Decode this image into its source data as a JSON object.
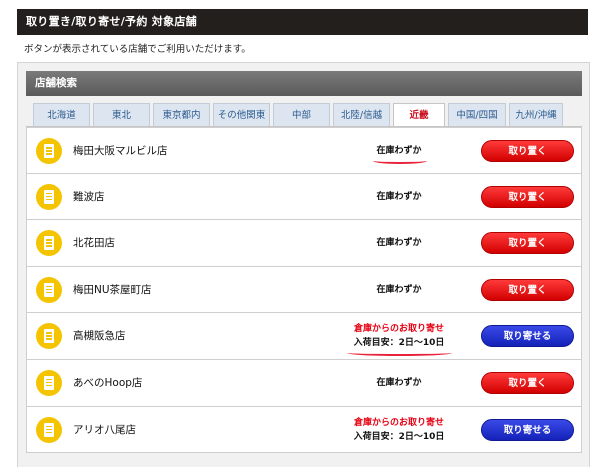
{
  "header": {
    "title": "取り置き/取り寄せ/予約 対象店舗",
    "subtitle": "ボタンが表示されている店舗でご利用いただけます。"
  },
  "panel": {
    "title": "店舗検索"
  },
  "tabs": [
    {
      "label": "北海道",
      "width": 57
    },
    {
      "label": "東北",
      "width": 57
    },
    {
      "label": "東京都内",
      "width": 57
    },
    {
      "label": "その他関東",
      "width": 57
    },
    {
      "label": "中部",
      "width": 57
    },
    {
      "label": "北陸/信越",
      "width": 57
    },
    {
      "label": "近畿",
      "width": 52
    },
    {
      "label": "中国/四国",
      "width": 58
    },
    {
      "label": "九州/沖縄",
      "width": 54
    }
  ],
  "active_tab": "近畿",
  "stores": [
    {
      "name": "梅田大阪マルビル店",
      "stock_line1": "在庫わずか",
      "stock_line2": "",
      "button": "取り置く",
      "button_type": "red"
    },
    {
      "name": "難波店",
      "stock_line1": "在庫わずか",
      "stock_line2": "",
      "button": "取り置く",
      "button_type": "red"
    },
    {
      "name": "北花田店",
      "stock_line1": "在庫わずか",
      "stock_line2": "",
      "button": "取り置く",
      "button_type": "red"
    },
    {
      "name": "梅田NU茶屋町店",
      "stock_line1": "在庫わずか",
      "stock_line2": "",
      "button": "取り置く",
      "button_type": "red"
    },
    {
      "name": "高槻阪急店",
      "stock_line1": "倉庫からのお取り寄せ",
      "stock_line2": "入荷目安：2日～10日",
      "button": "取り寄せる",
      "button_type": "blue"
    },
    {
      "name": "あべのHoop店",
      "stock_line1": "在庫わずか",
      "stock_line2": "",
      "button": "取り置く",
      "button_type": "red"
    },
    {
      "name": "アリオ八尾店",
      "stock_line1": "倉庫からのお取り寄せ",
      "stock_line2": "入荷目安：2日～10日",
      "button": "取り寄せる",
      "button_type": "blue"
    }
  ],
  "colors": {
    "header_bg": "#231f1c",
    "active_tab_text": "#cc1122",
    "alert_text": "#e60012",
    "button_red": "#e00000",
    "button_blue": "#1f2fd0",
    "store_icon": "#f5c400"
  },
  "icons": {
    "store": "store-building-icon"
  }
}
